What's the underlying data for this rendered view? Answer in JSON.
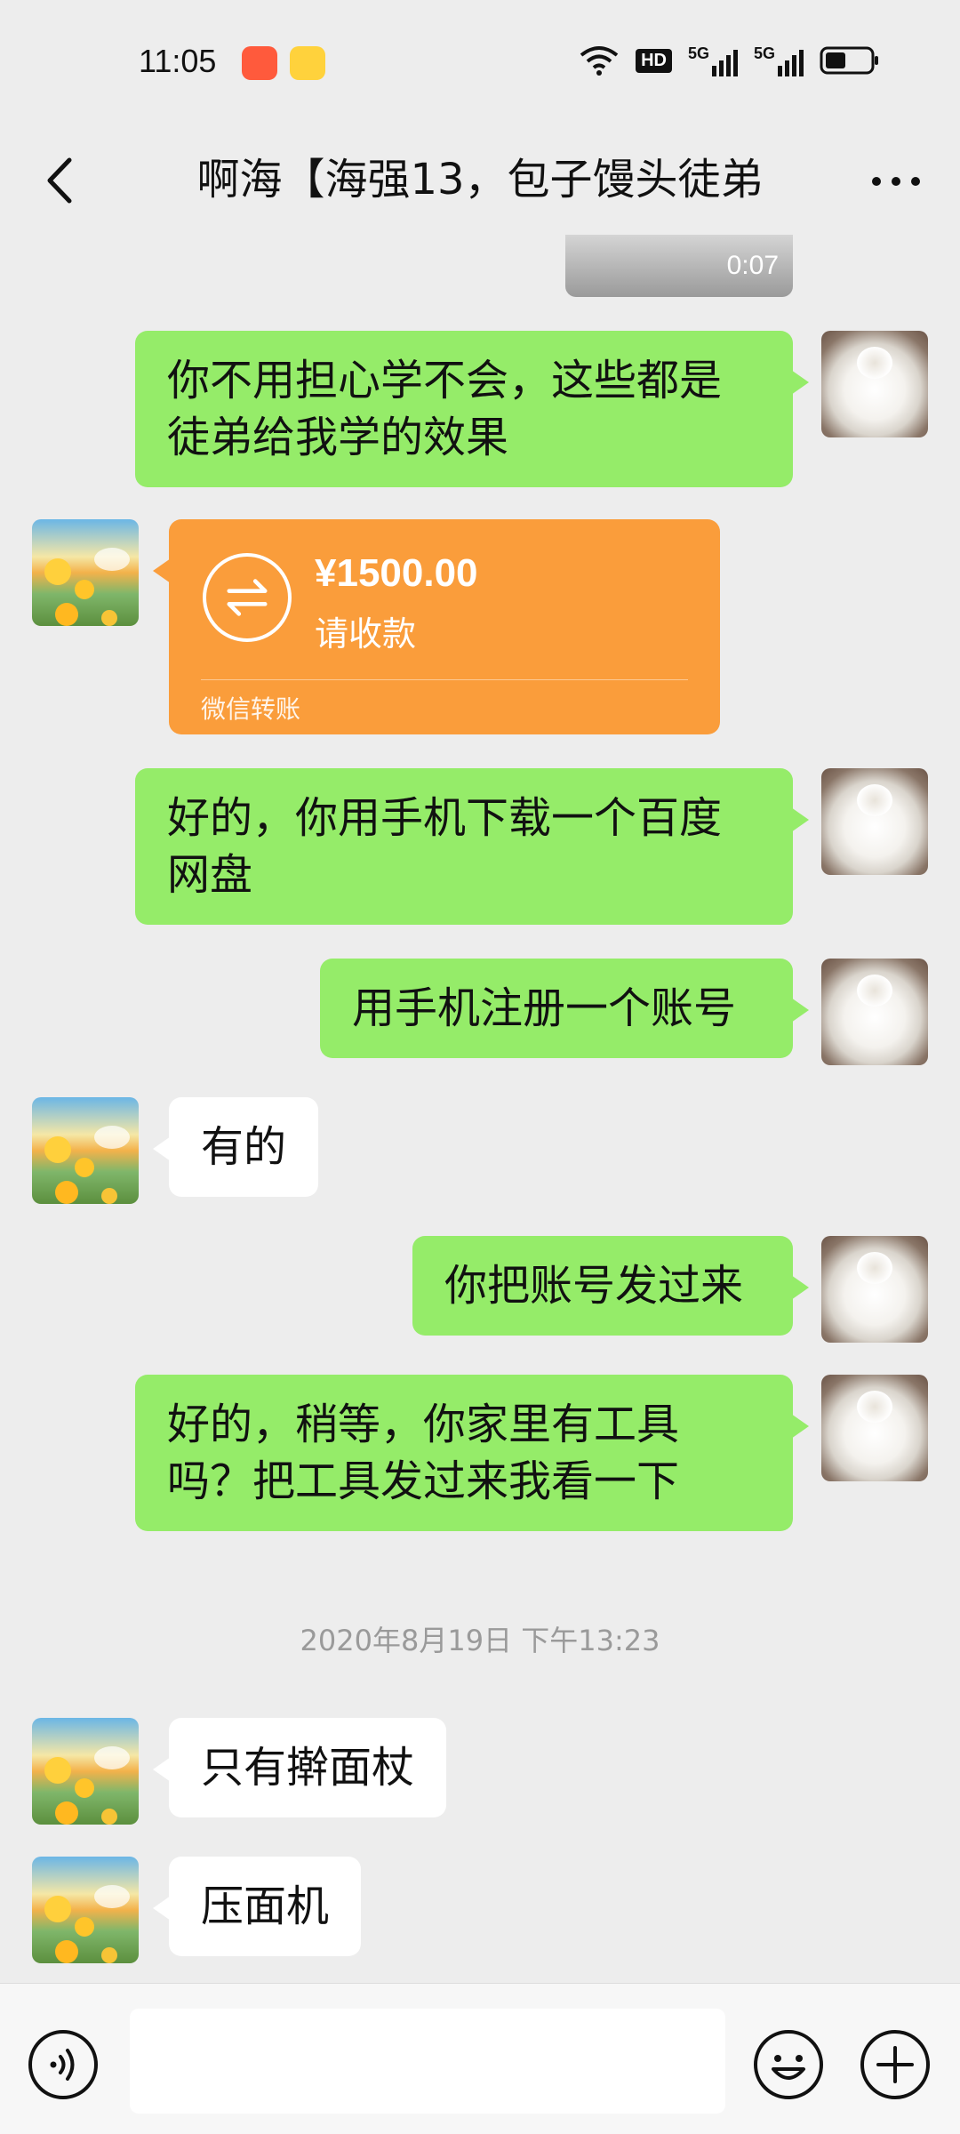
{
  "status": {
    "time": "11:05",
    "hd_label": "HD",
    "net1": "5G",
    "net2": "5G"
  },
  "header": {
    "title": "啊海【海强13，包子馒头徒弟"
  },
  "messages": {
    "voice_duration": "0:07",
    "m1": "你不用担心学不会，这些都是徒弟给我学的效果",
    "transfer": {
      "amount": "¥1500.00",
      "subtitle": "请收款",
      "footer": "微信转账"
    },
    "m2": "好的，你用手机下载一个百度网盘",
    "m3": "用手机注册一个账号",
    "m4": "有的",
    "m5": "你把账号发过来",
    "m6": "好的，稍等，你家里有工具吗？把工具发过来我看一下",
    "timestamp": "2020年8月19日 下午13:23",
    "m7": "只有擀面杖",
    "m8": "压面机"
  },
  "input": {
    "placeholder": ""
  },
  "colors": {
    "me_bubble": "#95ec69",
    "them_bubble": "#ffffff",
    "transfer": "#fa9d3b",
    "background": "#ededed"
  }
}
